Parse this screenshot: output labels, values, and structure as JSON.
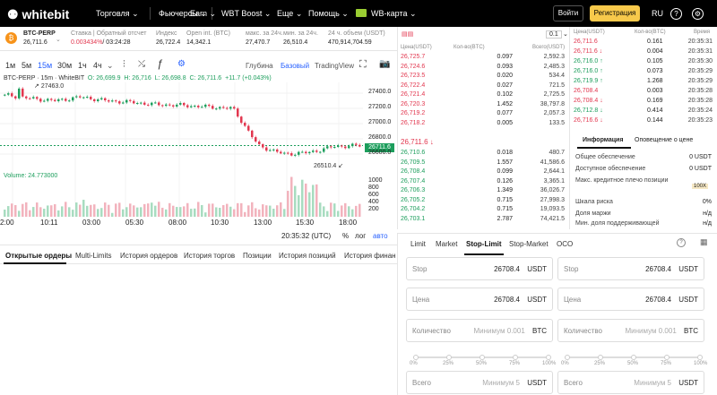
{
  "topbar": {
    "logo": "whitebit",
    "nav": [
      "Торговля ⌄",
      "Фьючерсы ⌄",
      "Earn ⌄",
      "WBT Boost ⌄",
      "Еще ⌄",
      "Помощь ⌄",
      "WB-карта ⌄"
    ],
    "login": "Войти",
    "register": "Регистрация",
    "lang": "RU"
  },
  "ticker": {
    "pair": "BTC-PERP",
    "price": "26,711.6",
    "funding_label": "Ставка | Обратный отсчет",
    "funding_rate": "0.003434%",
    "funding_countdown": "/ 03:24:28",
    "index_label": "Индекс",
    "index_value": "26,722.4",
    "oi_label": "Open int. (BTC)",
    "oi_value": "14,342.1",
    "high_label": "макс. за 24ч.",
    "high_value": "27,470.7",
    "low_label": "мин. за 24ч.",
    "low_value": "26,510.4",
    "vol_label": "24 ч. объем (USDT)",
    "vol_value": "470,914,704.59"
  },
  "toolbar": {
    "timeframes": [
      "1м",
      "5м",
      "15м",
      "30м",
      "1ч",
      "4ч"
    ],
    "active": "15м",
    "views": [
      "Глубина",
      "Базовый",
      "TradingView"
    ]
  },
  "chart": {
    "legend": "BTC-PERP · 15m · WhiteBIT",
    "O": "O: 26,699.9",
    "H": "H: 26,716",
    "L": "L: 26,698.8",
    "C": "C: 26,711.6",
    "chg": "+11.7 (+0.043%)",
    "high_mark": "27463.0",
    "low_mark": "26510.4",
    "last_price": "26711.6",
    "volume": "Volume: 24.773000",
    "price_ticks": [
      "27400.0",
      "27200.0",
      "27000.0",
      "26800.0",
      "26600.0"
    ],
    "vol_ticks": [
      "1000",
      "800",
      "600",
      "400",
      "200"
    ],
    "time_ticks": [
      "2:00",
      "10:11",
      "03:00",
      "05:30",
      "08:00",
      "10:30",
      "13:00",
      "15:30",
      "18:00"
    ],
    "clock": "20:35:32 (UTC)",
    "pct": "%",
    "log": "лог",
    "auto": "авто"
  },
  "chart_data": {
    "type": "candlestick",
    "title": "BTC-PERP · 15m · WhiteBIT",
    "x": [
      "10:11",
      "03:00",
      "05:30",
      "08:00",
      "10:30",
      "13:00",
      "15:30",
      "18:00"
    ],
    "close": [
      27380,
      27330,
      27300,
      27350,
      27300,
      27280,
      27250,
      27240,
      27220,
      27200,
      26710,
      26600,
      26620,
      26700,
      26711.6
    ],
    "ylim": [
      26500,
      27500
    ]
  },
  "bottom_tabs": [
    "Открытые ордеры",
    "Multi-Limits",
    "История ордеров",
    "История торгов",
    "Позиции",
    "История позиций",
    "История финанс"
  ],
  "orderbook": {
    "headers": [
      "Цена(USDT)",
      "Кол-во(BTC)",
      "Всего(USDT)"
    ],
    "step": "0.1",
    "asks": [
      [
        "26,725.7",
        "0.097",
        "2,592.3"
      ],
      [
        "26,724.6",
        "0.093",
        "2,485.3"
      ],
      [
        "26,723.5",
        "0.020",
        "534.4"
      ],
      [
        "26,722.4",
        "0.027",
        "721.5"
      ],
      [
        "26,721.4",
        "0.102",
        "2,725.5"
      ],
      [
        "26,720.3",
        "1.452",
        "38,797.8"
      ],
      [
        "26,719.2",
        "0.077",
        "2,057.3"
      ],
      [
        "26,718.2",
        "0.005",
        "133.5"
      ]
    ],
    "mid": "26,711.6 ↓",
    "bids": [
      [
        "26,710.6",
        "0.018",
        "480.7"
      ],
      [
        "26,709.5",
        "1.557",
        "41,586.6"
      ],
      [
        "26,708.4",
        "0.099",
        "2,644.1"
      ],
      [
        "26,707.4",
        "0.126",
        "3,365.1"
      ],
      [
        "26,706.3",
        "1.349",
        "36,026.7"
      ],
      [
        "26,705.2",
        "0.715",
        "27,998.3"
      ],
      [
        "26,704.2",
        "0.715",
        "19,093.5"
      ],
      [
        "26,703.1",
        "2.787",
        "74,421.5"
      ]
    ]
  },
  "trades": {
    "headers": [
      "Цена(USDT)",
      "Кол-во(BTC)",
      "Время"
    ],
    "rows": [
      [
        "26,711.6",
        "0.161",
        "20:35:31",
        "red"
      ],
      [
        "26,711.6 ↓",
        "0.004",
        "20:35:31",
        "red"
      ],
      [
        "26,716.0 ↑",
        "0.105",
        "20:35:30",
        "grn"
      ],
      [
        "26,716.0 ↑",
        "0.073",
        "20:35:29",
        "grn"
      ],
      [
        "26,719.9 ↑",
        "1.268",
        "20:35:29",
        "grn"
      ],
      [
        "26,708.4",
        "0.003",
        "20:35:28",
        "red"
      ],
      [
        "26,708.4 ↓",
        "0.169",
        "20:35:28",
        "red"
      ],
      [
        "26,712.8 ↓",
        "0.414",
        "20:35:24",
        "grn"
      ],
      [
        "26,716.6 ↓",
        "0.144",
        "20:35:23",
        "red"
      ]
    ]
  },
  "info": {
    "tabs": [
      "Информация",
      "Оповещение о цене"
    ],
    "rows": [
      [
        "Общее обеспечение",
        "0 USDT"
      ],
      [
        "Доступное обеспечение",
        "0 USDT"
      ],
      [
        "Макс. кредитное плечо позиции",
        "100X"
      ],
      [
        "Шкала риска",
        "0%"
      ],
      [
        "Доля маржи",
        "н/д"
      ],
      [
        "Мин. доля поддерживающей",
        "н/д"
      ]
    ]
  },
  "form": {
    "tabs": [
      "Limit",
      "Market",
      "Stop-Limit",
      "Stop-Market",
      "OCO"
    ],
    "active": "Stop-Limit",
    "stop_label": "Stop",
    "stop_value": "26708.4",
    "price_label": "Цена",
    "price_value": "26708.4",
    "unit_usdt": "USDT",
    "unit_btc": "BTC",
    "qty_label": "Количество",
    "qty_placeholder": "Минимум 0.001",
    "total_label": "Всего",
    "total_placeholder": "Минимум 5",
    "pcts": [
      "0%",
      "25%",
      "50%",
      "75%",
      "100%"
    ]
  }
}
